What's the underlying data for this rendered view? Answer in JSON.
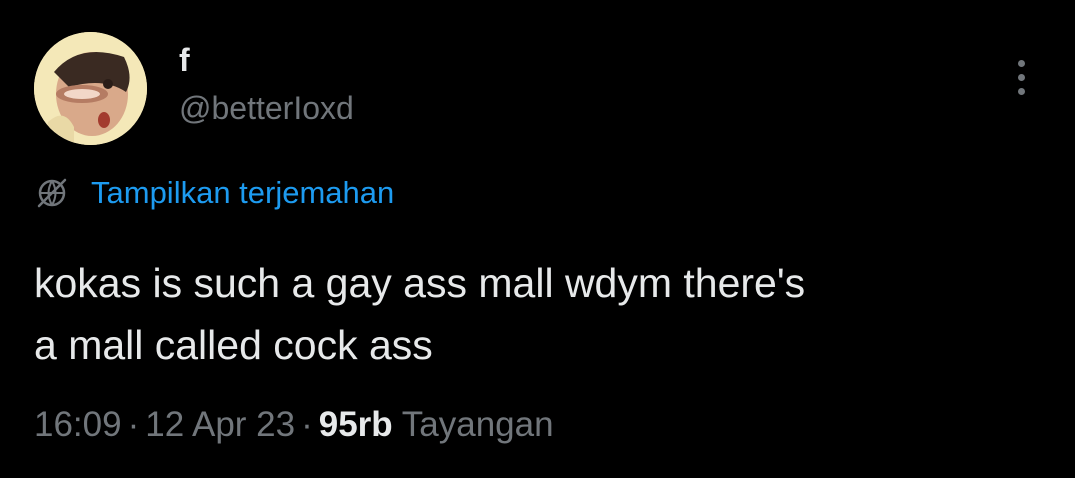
{
  "tweet": {
    "author": {
      "display_name": "f",
      "handle": "@betterIoxd"
    },
    "translate_label": "Tampilkan terjemahan",
    "text": "kokas is such a gay ass mall wdym there's\na mall called cock ass",
    "meta": {
      "time": "16:09",
      "separator": "·",
      "date": "12 Apr 23",
      "views_count": "95rb",
      "views_label": "Tayangan"
    },
    "icons": {
      "more": "more-horizontal-icon",
      "translate": "globe-icon"
    },
    "colors": {
      "background": "#000000",
      "primary_text": "#e7e9ea",
      "secondary_text": "#71767b",
      "accent": "#1d9bf0"
    }
  }
}
